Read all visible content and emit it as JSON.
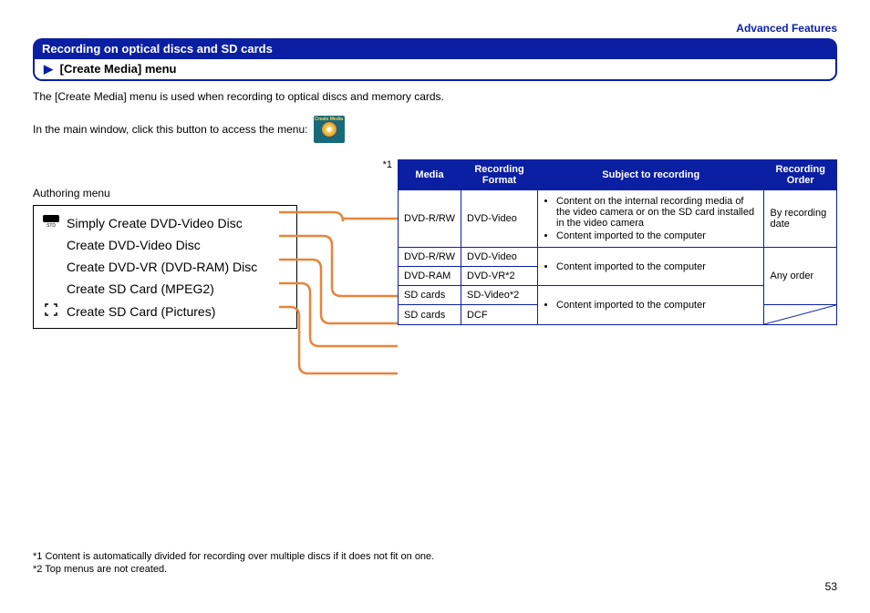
{
  "breadcrumb": "Advanced Features",
  "section_title": "Recording on optical discs and SD cards",
  "subsection_title": "[Create Media] menu",
  "intro": "The [Create Media] menu is used when recording to optical discs and memory cards.",
  "access_text": "In the main window, click this button to access the menu:",
  "cm_icon_label": "Create Media",
  "menu_label": "Authoring menu",
  "menu_items": [
    "Simply Create DVD-Video Disc",
    "Create DVD-Video Disc",
    "Create DVD-VR (DVD-RAM) Disc",
    "Create SD Card (MPEG2)",
    "Create SD Card (Pictures)"
  ],
  "asterisk1": "*1",
  "table_headers": {
    "media": "Media",
    "format": "Recording Format",
    "subject": "Subject to recording",
    "order": "Recording Order"
  },
  "table_rows": [
    {
      "media": "DVD-R/RW",
      "format": "DVD-Video",
      "subject_list": [
        "Content on the internal recording media of the video camera or on the SD card installed in the video camera",
        "Content imported to the computer"
      ],
      "order": "By recording date"
    },
    {
      "media": "DVD-R/RW",
      "format": "DVD-Video",
      "subject_list": [
        "Content imported to the computer"
      ],
      "order": "Any order"
    },
    {
      "media": "DVD-RAM",
      "format": "DVD-VR*2"
    },
    {
      "media": "SD cards",
      "format": "SD-Video*2",
      "subject_list": [
        "Content imported to the computer"
      ]
    },
    {
      "media": "SD cards",
      "format": "DCF"
    }
  ],
  "footnotes": {
    "f1": "*1 Content is automatically divided for recording over multiple discs if it does not fit on one.",
    "f2": "*2 Top menus are not created."
  },
  "page_number": "53"
}
